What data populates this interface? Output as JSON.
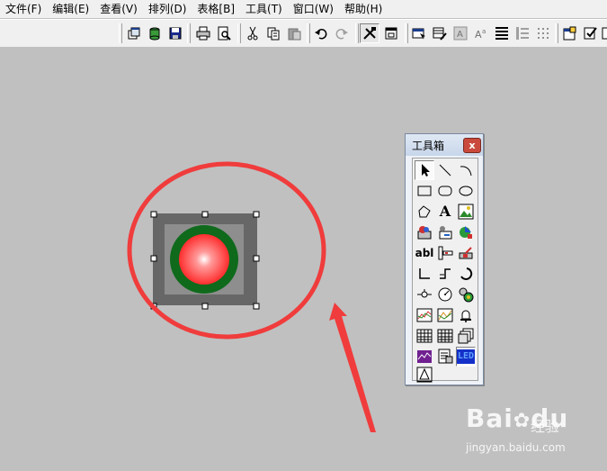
{
  "menu": [
    "文件(F)",
    "编辑(E)",
    "查看(V)",
    "排列(D)",
    "表格[B]",
    "工具(T)",
    "窗口(W)",
    "帮助(H)"
  ],
  "toolbar_icons": [
    "new-window-icon",
    "database-icon",
    "save-icon",
    "print-icon",
    "print-preview-icon",
    "cut-icon",
    "copy-icon",
    "paste-icon",
    "undo-icon",
    "redo-icon",
    "tools-icon",
    "window-icon",
    "properties-icon",
    "database-edit-icon",
    "font-icon",
    "font-size-icon",
    "align-icon",
    "list-icon",
    "grid-icon",
    "page-setup-icon",
    "check-icon",
    "more-icon"
  ],
  "toolbox": {
    "title": "工具箱",
    "close_label": "x",
    "text_tool_label": "A",
    "textbox_tool_label": "abl",
    "led_tool_label": "LED",
    "tools": [
      "pointer-tool",
      "line-tool",
      "arc-tool",
      "rectangle-tool",
      "rounded-rect-tool",
      "ellipse-tool",
      "polygon-tool",
      "text-tool",
      "bitmap-tool",
      "button-tool",
      "label-tool",
      "navigation-tool",
      "textbox-tool",
      "slider-tool",
      "switch-tool",
      "pipe-tool",
      "step-tool",
      "curve-tool",
      "valve-tool",
      "gauge-tool",
      "indicator-tool",
      "trend-tool",
      "xy-curve-tool",
      "alarm-tool",
      "table-tool",
      "grid-tool",
      "window-tool",
      "chart-tool",
      "report-tool",
      "led-tool",
      "animation-tool"
    ]
  },
  "indicator_light": {
    "state": "red"
  },
  "watermark": {
    "logo": "Bai",
    "logo_du": "du",
    "cn": "经验",
    "url": "jingyan.baidu.com"
  },
  "colors": {
    "background": "#c0c0c0",
    "annotation": "#f03c3c",
    "light_ring": "#0f6a1c",
    "light_center": "#ff4848"
  }
}
